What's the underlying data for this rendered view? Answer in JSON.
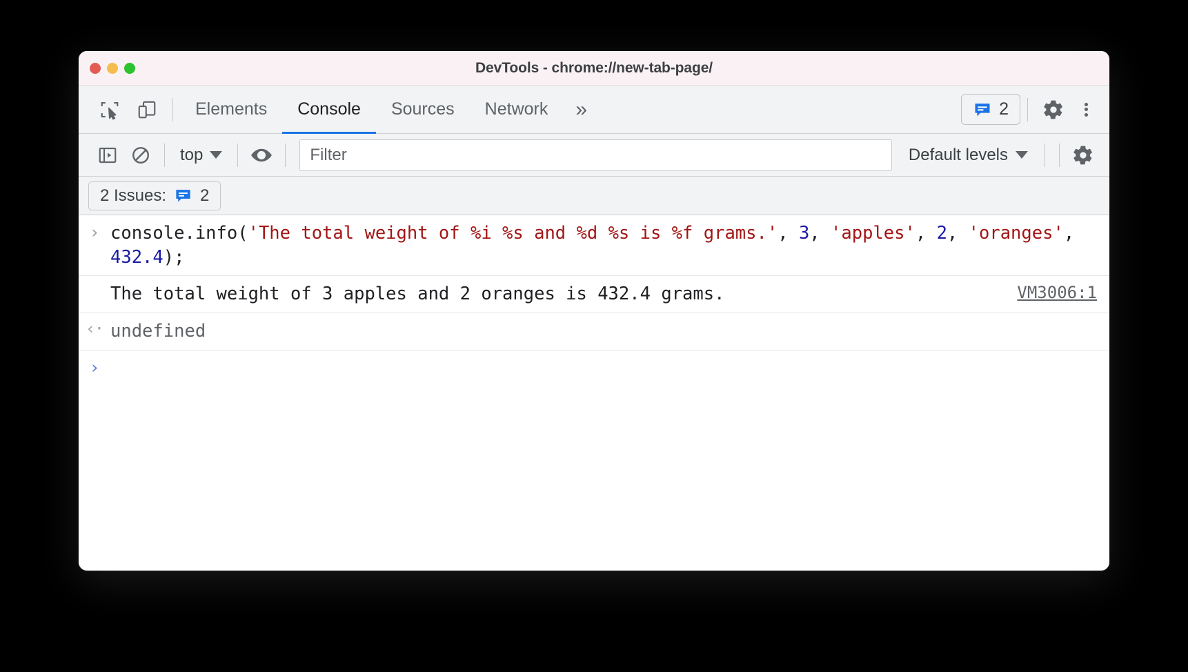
{
  "titlebar": {
    "title": "DevTools - chrome://new-tab-page/",
    "traffic_lights": [
      {
        "name": "close",
        "color": "#e25c54"
      },
      {
        "name": "minimize",
        "color": "#f4bd4e"
      },
      {
        "name": "maximize",
        "color": "#2dc22f"
      }
    ]
  },
  "tabbar": {
    "inspect_icon": "inspect-element-icon",
    "device_icon": "device-toolbar-icon",
    "tabs": [
      {
        "label": "Elements",
        "active": false
      },
      {
        "label": "Console",
        "active": true
      },
      {
        "label": "Sources",
        "active": false
      },
      {
        "label": "Network",
        "active": false
      }
    ],
    "more_tabs_label": "»",
    "issues_count": "2",
    "settings_icon": "gear-icon",
    "more_options_icon": "kebab-menu-icon"
  },
  "filterbar": {
    "sidebar_toggle_icon": "console-sidebar-icon",
    "clear_console_icon": "clear-console-icon",
    "context_label": "top",
    "eye_icon": "live-expression-icon",
    "filter_placeholder": "Filter",
    "filter_value": "",
    "levels_label": "Default levels",
    "settings_icon": "gear-icon"
  },
  "issues_bar": {
    "label": "2 Issues:",
    "count": "2"
  },
  "console": {
    "input_row": {
      "prompt_glyph": "›",
      "tokens": [
        {
          "t": "console.info(",
          "k": "plain"
        },
        {
          "t": "'The total weight of %i %s and %d %s is %f grams.'",
          "k": "str"
        },
        {
          "t": ", ",
          "k": "plain"
        },
        {
          "t": "3",
          "k": "num"
        },
        {
          "t": ", ",
          "k": "plain"
        },
        {
          "t": "'apples'",
          "k": "str"
        },
        {
          "t": ", ",
          "k": "plain"
        },
        {
          "t": "2",
          "k": "num"
        },
        {
          "t": ", ",
          "k": "plain"
        },
        {
          "t": "'oranges'",
          "k": "str"
        },
        {
          "t": ", ",
          "k": "plain"
        },
        {
          "t": "432.4",
          "k": "num"
        },
        {
          "t": ");",
          "k": "plain"
        }
      ]
    },
    "output_row": {
      "text": "The total weight of 3 apples and 2 oranges is 432.4 grams.",
      "source": "VM3006:1"
    },
    "result_row": {
      "prompt_glyph": "‹·",
      "value": "undefined"
    },
    "new_prompt": {
      "prompt_glyph": "›"
    }
  },
  "colors": {
    "accent": "#1a73e8",
    "string": "#a31515",
    "number": "#1a1aa6",
    "muted": "#5f6368"
  }
}
